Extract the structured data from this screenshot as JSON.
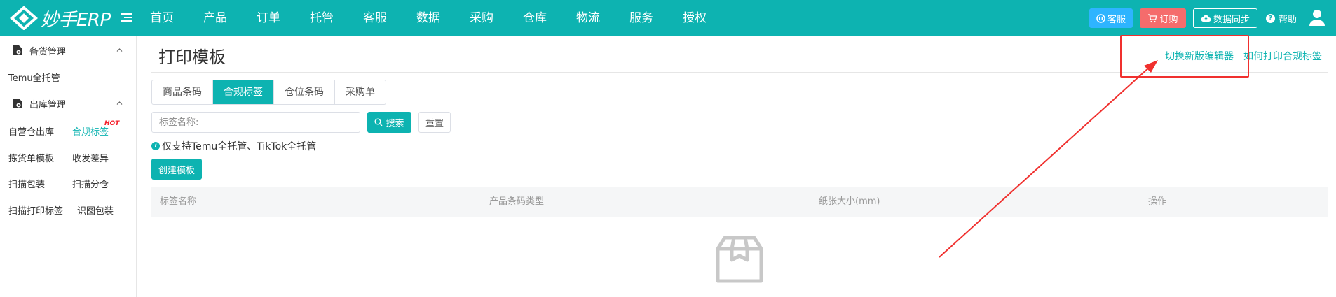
{
  "app": {
    "logo_text": "妙手ERP"
  },
  "nav": {
    "items": [
      "首页",
      "产品",
      "订单",
      "托管",
      "客服",
      "数据",
      "采购",
      "仓库",
      "物流",
      "服务",
      "授权"
    ]
  },
  "top_actions": {
    "service": "客服",
    "order": "订购",
    "sync": "数据同步",
    "help": "帮助"
  },
  "sidebar": {
    "group1": "备货管理",
    "temu": "Temu全托管",
    "group2": "出库管理",
    "items": {
      "self_warehouse": "自营仓出库",
      "compliance_label": "合规标签",
      "hot_badge": "HOT",
      "picking_template": "拣货单模板",
      "receive_diff": "收发差异",
      "scan_pack": "扫描包装",
      "scan_sort": "扫描分仓",
      "scan_print": "扫描打印标签",
      "image_pack": "识图包装"
    }
  },
  "main": {
    "title": "打印模板",
    "link_switch": "切换新版编辑器",
    "link_howto": "如何打印合规标签",
    "tabs": [
      "商品条码",
      "合规标签",
      "仓位条码",
      "采购单"
    ],
    "active_tab": "合规标签",
    "search_placeholder": "标签名称:",
    "search_btn": "搜索",
    "reset_btn": "重置",
    "notice": "仅支持Temu全托管、TikTok全托管",
    "create_btn": "创建模板",
    "table_headers": [
      "标签名称",
      "产品条码类型",
      "纸张大小(mm)",
      "操作"
    ]
  },
  "colors": {
    "primary": "#0db3b1",
    "service_btn": "#2eb4ff",
    "order_btn": "#f56c6c",
    "annotation": "#f0302e"
  }
}
